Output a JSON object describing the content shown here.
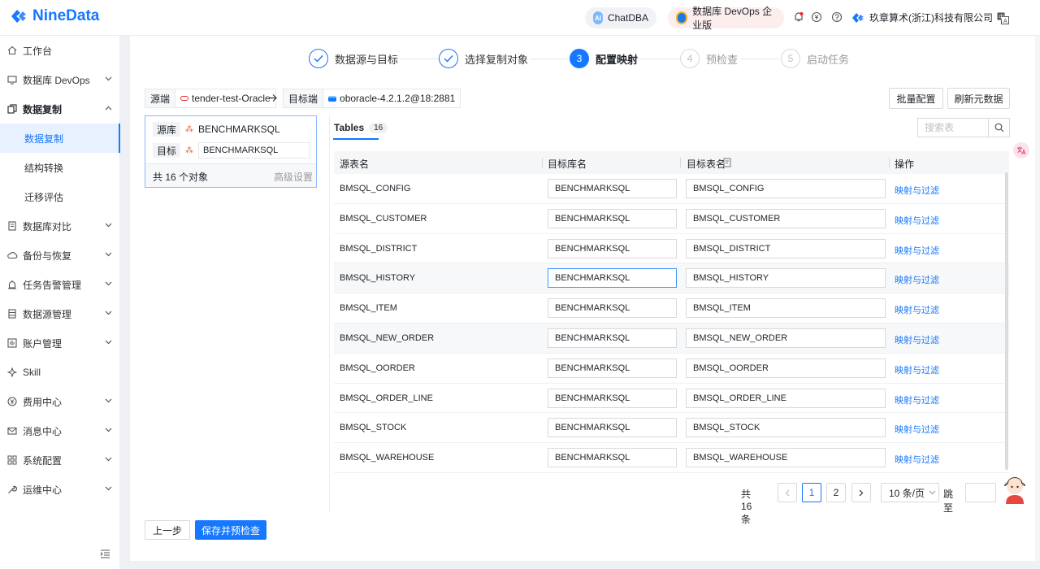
{
  "header": {
    "logo_text": "NineData",
    "chatdba_label": "ChatDBA",
    "devops_label": "数据库 DevOps 企业版",
    "company_name": "玖章算术(浙江)科技有限公司",
    "accent": "#1677ff"
  },
  "sidebar": {
    "items": [
      {
        "label": "工作台",
        "icon": "home-icon"
      },
      {
        "label": "数据库 DevOps",
        "icon": "monitor-icon"
      },
      {
        "label": "数据复制",
        "icon": "copy-icon"
      },
      {
        "label": "数据复制"
      },
      {
        "label": "结构转换"
      },
      {
        "label": "迁移评估"
      },
      {
        "label": "数据库对比",
        "icon": "compare-icon"
      },
      {
        "label": "备份与恢复",
        "icon": "cloud-icon"
      },
      {
        "label": "任务告警管理",
        "icon": "alarm-icon"
      },
      {
        "label": "数据源管理",
        "icon": "database-icon"
      },
      {
        "label": "账户管理",
        "icon": "account-icon"
      },
      {
        "label": "Skill",
        "icon": "skill-icon"
      },
      {
        "label": "费用中心",
        "icon": "yen-icon"
      },
      {
        "label": "消息中心",
        "icon": "mail-icon"
      },
      {
        "label": "系统配置",
        "icon": "grid-icon"
      },
      {
        "label": "运维中心",
        "icon": "wrench-icon"
      }
    ]
  },
  "steps": [
    {
      "num": "",
      "label": "数据源与目标",
      "status": "done"
    },
    {
      "num": "",
      "label": "选择复制对象",
      "status": "done"
    },
    {
      "num": "3",
      "label": "配置映射",
      "status": "current"
    },
    {
      "num": "4",
      "label": "预检查",
      "status": "wait"
    },
    {
      "num": "5",
      "label": "启动任务",
      "status": "wait"
    }
  ],
  "source": {
    "key": "源端",
    "value": "tender-test-Oracle"
  },
  "target": {
    "key": "目标端",
    "value": "oboracle-4.2.1.2@18:2881"
  },
  "buttons": {
    "batch": "批量配置",
    "refresh": "刷新元数据",
    "prev": "上一步",
    "save": "保存并预检查"
  },
  "left_panel": {
    "src_key": "源库",
    "src_value": "BENCHMARKSQL",
    "tgt_key": "目标",
    "tgt_value": "BENCHMARKSQL",
    "count": "共 16 个对象",
    "advanced": "高级设置"
  },
  "tabs": {
    "label": "Tables",
    "count": "16"
  },
  "search": {
    "placeholder": "搜索表"
  },
  "table": {
    "headers": [
      "源表名",
      "目标库名",
      "目标表名",
      "操作"
    ],
    "rows": [
      {
        "src": "BMSQL_CONFIG",
        "db": "BENCHMARKSQL",
        "tbl": "BMSQL_CONFIG",
        "op": "映射与过滤"
      },
      {
        "src": "BMSQL_CUSTOMER",
        "db": "BENCHMARKSQL",
        "tbl": "BMSQL_CUSTOMER",
        "op": "映射与过滤"
      },
      {
        "src": "BMSQL_DISTRICT",
        "db": "BENCHMARKSQL",
        "tbl": "BMSQL_DISTRICT",
        "op": "映射与过滤"
      },
      {
        "src": "BMSQL_HISTORY",
        "db": "BENCHMARKSQL",
        "tbl": "BMSQL_HISTORY",
        "op": "映射与过滤"
      },
      {
        "src": "BMSQL_ITEM",
        "db": "BENCHMARKSQL",
        "tbl": "BMSQL_ITEM",
        "op": "映射与过滤"
      },
      {
        "src": "BMSQL_NEW_ORDER",
        "db": "BENCHMARKSQL",
        "tbl": "BMSQL_NEW_ORDER",
        "op": "映射与过滤"
      },
      {
        "src": "BMSQL_OORDER",
        "db": "BENCHMARKSQL",
        "tbl": "BMSQL_OORDER",
        "op": "映射与过滤"
      },
      {
        "src": "BMSQL_ORDER_LINE",
        "db": "BENCHMARKSQL",
        "tbl": "BMSQL_ORDER_LINE",
        "op": "映射与过滤"
      },
      {
        "src": "BMSQL_STOCK",
        "db": "BENCHMARKSQL",
        "tbl": "BMSQL_STOCK",
        "op": "映射与过滤"
      },
      {
        "src": "BMSQL_WAREHOUSE",
        "db": "BENCHMARKSQL",
        "tbl": "BMSQL_WAREHOUSE",
        "op": "映射与过滤"
      }
    ]
  },
  "pagination": {
    "total": "共 16 条",
    "page1": "1",
    "page2": "2",
    "page_size": "10 条/页",
    "jump": "跳至",
    "jump_value": ""
  }
}
